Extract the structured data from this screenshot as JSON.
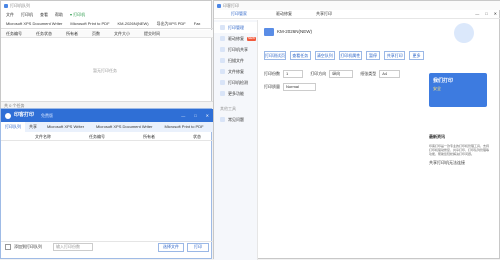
{
  "left_window": {
    "title": "打印机队列",
    "menu": [
      "文件",
      "打印机",
      "查看",
      "帮助"
    ],
    "menu_right": "打印机",
    "printer_tabs": [
      "Microsoft XPS Document Writer",
      "Microsoft Print to PDF",
      "KM-2026N(NEW)",
      "导出为XPS PDF",
      "Fax"
    ],
    "queue_headers": [
      "任务编号",
      "任务状态",
      "所有者",
      "页数",
      "文件大小",
      "提交时间"
    ],
    "empty_text": "暂无打印任务",
    "statusbar": "共 0 个任务"
  },
  "bottom_window": {
    "logo": "印客打印",
    "badge": "免费版",
    "win_controls": [
      "—",
      "□",
      "✕"
    ],
    "tabs": [
      "打印队列",
      "共享",
      "Microsoft XPS Writer",
      "Microsoft XPS Document Writer",
      "Microsoft Print to PDF",
      "其它"
    ],
    "columns": [
      "文件名称",
      "任务编号",
      "所有者",
      "状态"
    ],
    "footer_checkbox": "添加到打印队列",
    "footer_input_placeholder": "输入打印份数",
    "footer_buttons": [
      "选择文件",
      "打印"
    ]
  },
  "right_window": {
    "title": "印客打印",
    "top_tabs": [
      "打印管家",
      "驱动修复",
      "共享打印"
    ],
    "win_controls": [
      "—",
      "□",
      "✕"
    ],
    "sidebar": [
      {
        "label": "打印管理",
        "active": true,
        "badge": ""
      },
      {
        "label": "驱动修复",
        "active": false,
        "badge": "NEW"
      },
      {
        "label": "打印机共享",
        "active": false,
        "badge": ""
      },
      {
        "label": "扫描文件",
        "active": false,
        "badge": ""
      },
      {
        "label": "文件修复",
        "active": false,
        "badge": ""
      },
      {
        "label": "打印机检测",
        "active": false,
        "badge": ""
      },
      {
        "label": "更多功能",
        "active": false,
        "badge": ""
      }
    ],
    "sidebar_section": "其他工具",
    "sidebar_extra": "常见问题",
    "printer_name": "KM-2026N(NEW)",
    "action_buttons": [
      "打印测试页",
      "查看任务",
      "清空队列",
      "打印机属性",
      "暂停",
      "共享打印",
      "更多"
    ],
    "settings_labels": [
      "打印份数",
      "打印方向",
      "纸张类型"
    ],
    "settings_values": [
      "1",
      "纵向",
      "A4"
    ],
    "quality_label": "打印质量",
    "quality_value": "Normal",
    "ad_line1": "我们打印",
    "ad_line2": "安全",
    "section_title": "最新资讯",
    "news_body": "印客打印是一款专业的打印机管理工具，支持打印机驱动修复、共享打印、打印队列管理等功能，帮助您轻松解决打印问题。",
    "news_item": "共享打印机无法连接"
  }
}
